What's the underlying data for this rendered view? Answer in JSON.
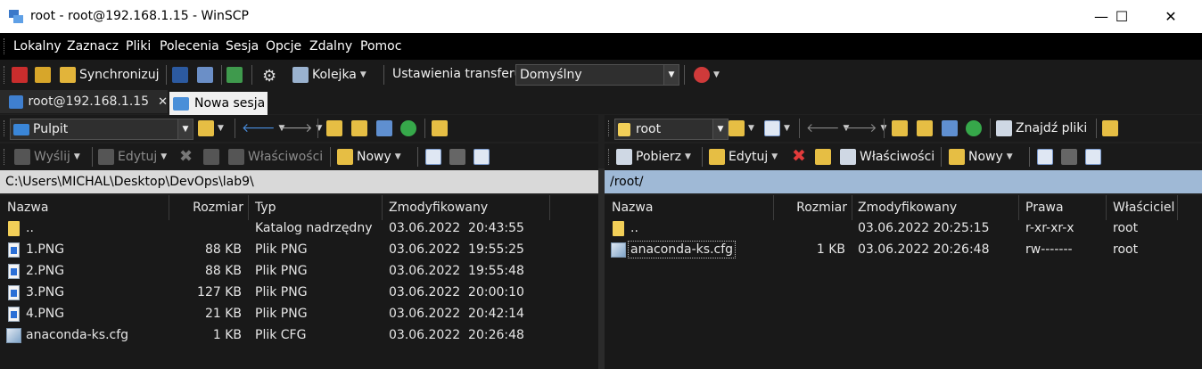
{
  "window": {
    "title": "root - root@192.168.1.15 - WinSCP",
    "minimize": "—",
    "maximize": "☐",
    "close": "✕"
  },
  "menu": [
    "Lokalny",
    "Zaznacz",
    "Pliki",
    "Polecenia",
    "Sesja",
    "Opcje",
    "Zdalny",
    "Pomoc"
  ],
  "toolbar": {
    "synchronize": "Synchronizuj",
    "queue": "Kolejka",
    "transfer_settings_label": "Ustawienia transferu",
    "transfer_settings_value": "Domyślny"
  },
  "tabs": [
    {
      "label": "root@192.168.1.15",
      "close": "✕"
    },
    {
      "label": "Nowa sesja"
    }
  ],
  "left": {
    "location": "Pulpit",
    "actions": {
      "send": "Wyślij",
      "edit": "Edytuj",
      "properties": "Właściwości",
      "new": "Nowy"
    },
    "path": "C:\\Users\\MICHAL\\Desktop\\DevOps\\lab9\\",
    "columns": {
      "name": "Nazwa",
      "size": "Rozmiar",
      "type": "Typ",
      "modified": "Zmodyfikowany"
    },
    "rows": [
      {
        "icon": "parent-folder-icon",
        "name": "..",
        "size": "",
        "type": "Katalog nadrzędny",
        "modified": "03.06.2022  20:43:55"
      },
      {
        "icon": "png-file-icon",
        "name": "1.PNG",
        "size": "88 KB",
        "type": "Plik PNG",
        "modified": "03.06.2022  19:55:25"
      },
      {
        "icon": "png-file-icon",
        "name": "2.PNG",
        "size": "88 KB",
        "type": "Plik PNG",
        "modified": "03.06.2022  19:55:48"
      },
      {
        "icon": "png-file-icon",
        "name": "3.PNG",
        "size": "127 KB",
        "type": "Plik PNG",
        "modified": "03.06.2022  20:00:10"
      },
      {
        "icon": "png-file-icon",
        "name": "4.PNG",
        "size": "21 KB",
        "type": "Plik PNG",
        "modified": "03.06.2022  20:42:14"
      },
      {
        "icon": "cfg-file-icon",
        "name": "anaconda-ks.cfg",
        "size": "1 KB",
        "type": "Plik CFG",
        "modified": "03.06.2022  20:26:48"
      }
    ]
  },
  "right": {
    "location": "root",
    "actions": {
      "download": "Pobierz",
      "edit": "Edytuj",
      "properties": "Właściwości",
      "new": "Nowy",
      "find": "Znajdź pliki"
    },
    "path": "/root/",
    "columns": {
      "name": "Nazwa",
      "size": "Rozmiar",
      "modified": "Zmodyfikowany",
      "rights": "Prawa",
      "owner": "Właściciel"
    },
    "rows": [
      {
        "icon": "parent-folder-icon",
        "name": "..",
        "size": "",
        "modified": "03.06.2022 20:25:15",
        "rights": "r-xr-xr-x",
        "owner": "root"
      },
      {
        "icon": "cfg-file-icon",
        "name": "anaconda-ks.cfg",
        "size": "1 KB",
        "modified": "03.06.2022 20:26:48",
        "rights": "rw-------",
        "owner": "root"
      }
    ]
  },
  "colors": {
    "path_active": "#9fb9d6",
    "path_inactive": "#d6d6d6",
    "menu_bg": "#000000",
    "panel_bg": "#191919"
  }
}
